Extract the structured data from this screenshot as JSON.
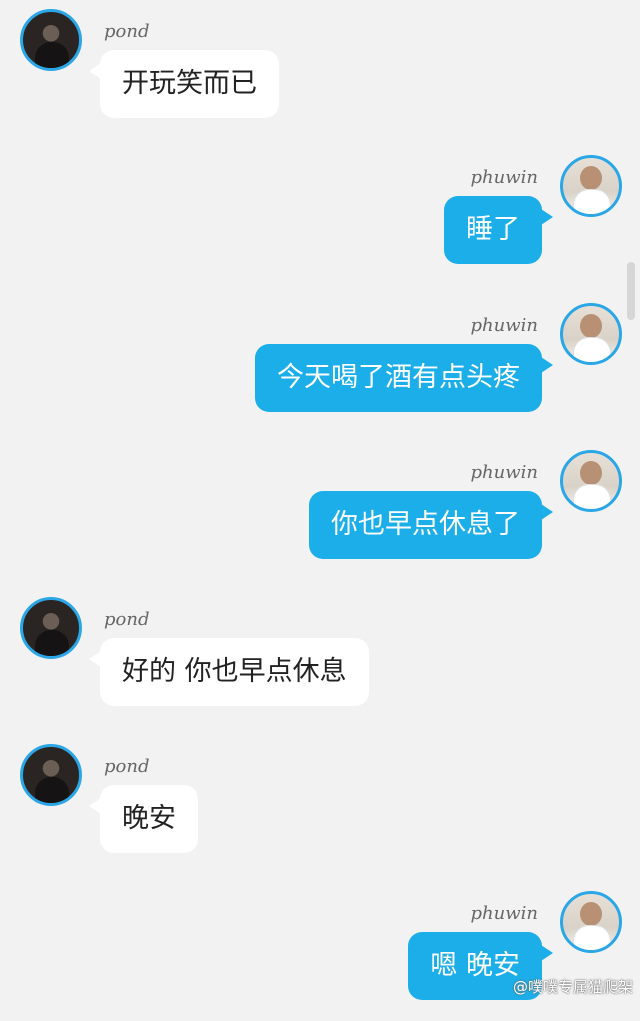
{
  "messages": [
    {
      "sender": "pond",
      "text": "开玩笑而已",
      "side": "left"
    },
    {
      "sender": "phuwin",
      "text": "睡了",
      "side": "right"
    },
    {
      "sender": "phuwin",
      "text": "今天喝了酒有点头疼",
      "side": "right"
    },
    {
      "sender": "phuwin",
      "text": "你也早点休息了",
      "side": "right"
    },
    {
      "sender": "pond",
      "text": "好的 你也早点休息",
      "side": "left"
    },
    {
      "sender": "pond",
      "text": "晚安",
      "side": "left"
    },
    {
      "sender": "phuwin",
      "text": "嗯 晚安",
      "side": "right"
    }
  ],
  "watermark": "@噗噗专属猫爬架",
  "colors": {
    "background": "#f2f2f2",
    "left_bubble": "#ffffff",
    "right_bubble": "#1caee8",
    "avatar_ring": "#2ba6e6"
  }
}
